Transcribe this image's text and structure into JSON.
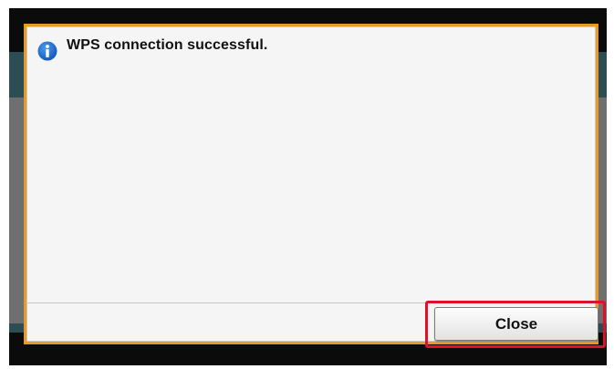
{
  "dialog": {
    "icon": "info-icon",
    "message": "WPS connection successful.",
    "close_label": "Close"
  },
  "colors": {
    "dialog_border": "#e89a25",
    "highlight_border": "#e0102a",
    "info_icon": "#1a73d9",
    "screen_background": "#0b0b0b",
    "band": "#2d4d55"
  }
}
